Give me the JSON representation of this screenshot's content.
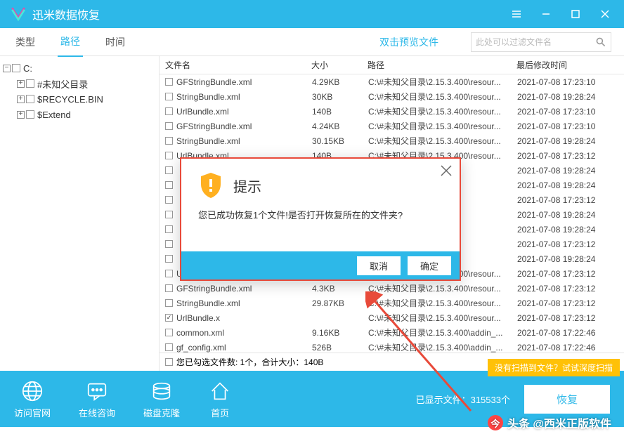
{
  "app": {
    "title": "迅米数据恢复"
  },
  "tabs": {
    "type": "类型",
    "path": "路径",
    "time": "时间",
    "preview": "双击预览文件"
  },
  "search": {
    "placeholder": "此处可以过滤文件名"
  },
  "tree": {
    "root": "C:",
    "children": [
      {
        "label": "#未知父目录"
      },
      {
        "label": "$RECYCLE.BIN"
      },
      {
        "label": "$Extend"
      }
    ]
  },
  "columns": {
    "name": "文件名",
    "size": "大小",
    "path": "路径",
    "date": "最后修改时间"
  },
  "rows": [
    {
      "n": "GFStringBundle.xml",
      "s": "4.29KB",
      "p": "C:\\#未知父目录\\2.15.3.400\\resour...",
      "d": "2021-07-08 17:23:10"
    },
    {
      "n": "StringBundle.xml",
      "s": "30KB",
      "p": "C:\\#未知父目录\\2.15.3.400\\resour...",
      "d": "2021-07-08 19:28:24"
    },
    {
      "n": "UrlBundle.xml",
      "s": "140B",
      "p": "C:\\#未知父目录\\2.15.3.400\\resour...",
      "d": "2021-07-08 17:23:10"
    },
    {
      "n": "GFStringBundle.xml",
      "s": "4.24KB",
      "p": "C:\\#未知父目录\\2.15.3.400\\resour...",
      "d": "2021-07-08 17:23:10"
    },
    {
      "n": "StringBundle.xml",
      "s": "30.15KB",
      "p": "C:\\#未知父目录\\2.15.3.400\\resour...",
      "d": "2021-07-08 19:28:24"
    },
    {
      "n": "UrlBundle.xml",
      "s": "140B",
      "p": "C:\\#未知父目录\\2.15.3.400\\resour...",
      "d": "2021-07-08 17:23:12"
    },
    {
      "n": "",
      "s": "",
      "p": "5.3.400\\resour...",
      "d": "2021-07-08 19:28:24"
    },
    {
      "n": "",
      "s": "",
      "p": "5.3.400\\resour...",
      "d": "2021-07-08 19:28:24"
    },
    {
      "n": "",
      "s": "",
      "p": "5.3.400\\resour...",
      "d": "2021-07-08 17:23:12"
    },
    {
      "n": "",
      "s": "",
      "p": "5.3.400\\resour...",
      "d": "2021-07-08 19:28:24"
    },
    {
      "n": "",
      "s": "",
      "p": "5.3.400\\resour...",
      "d": "2021-07-08 19:28:24"
    },
    {
      "n": "",
      "s": "",
      "p": "5.3.400\\resour...",
      "d": "2021-07-08 17:23:12"
    },
    {
      "n": "",
      "s": "",
      "p": "5.3.400\\resour...",
      "d": "2021-07-08 19:28:24"
    },
    {
      "n": "UrlBundle.xml",
      "s": "140B",
      "p": "C:\\#未知父目录\\2.15.3.400\\resour...",
      "d": "2021-07-08 17:23:12"
    },
    {
      "n": "GFStringBundle.xml",
      "s": "4.3KB",
      "p": "C:\\#未知父目录\\2.15.3.400\\resour...",
      "d": "2021-07-08 17:23:12"
    },
    {
      "n": "StringBundle.xml",
      "s": "29.87KB",
      "p": "C:\\#未知父目录\\2.15.3.400\\resour...",
      "d": "2021-07-08 17:23:12"
    },
    {
      "n": "UrlBundle.x",
      "s": "",
      "p": "C:\\#未知父目录\\2.15.3.400\\resour...",
      "d": "2021-07-08 17:23:12",
      "checked": true
    },
    {
      "n": "common.xml",
      "s": "9.16KB",
      "p": "C:\\#未知父目录\\2.15.3.400\\addin_...",
      "d": "2021-07-08 17:22:46"
    },
    {
      "n": "gf_config.xml",
      "s": "526B",
      "p": "C:\\#未知父目录\\2.15.3.400\\addin_...",
      "d": "2021-07-08 17:22:46"
    }
  ],
  "summary": "您已勾选文件数: 1个，合计大小：140B",
  "deep_scan": "没有扫描到文件？试试深度扫描",
  "footer": {
    "site": "访问官网",
    "chat": "在线咨询",
    "clone": "磁盘克隆",
    "home": "首页",
    "status_prefix": "已显示文件：",
    "status_count": "315533个",
    "recover": "恢复"
  },
  "dialog": {
    "title": "提示",
    "msg": "您已成功恢复1个文件!是否打开恢复所在的文件夹?",
    "cancel": "取消",
    "ok": "确定"
  },
  "watermark": "头条 @西米正版软件"
}
